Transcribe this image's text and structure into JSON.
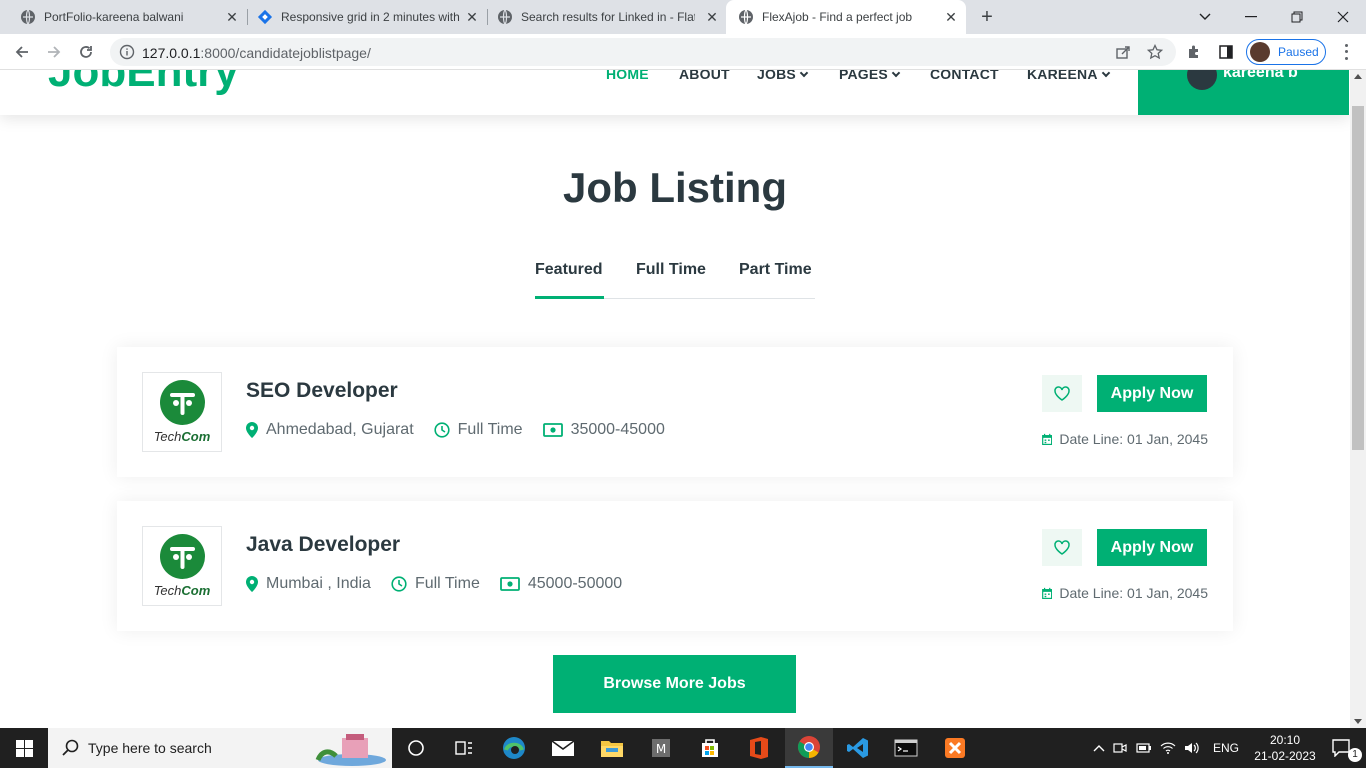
{
  "browser": {
    "tabs": [
      {
        "title": "PortFolio-kareena balwani",
        "active": false
      },
      {
        "title": "Responsive grid in 2 minutes with",
        "active": false
      },
      {
        "title": "Search results for Linked in - Flat",
        "active": false
      },
      {
        "title": "FlexAjob - Find a perfect job",
        "active": true
      }
    ],
    "url_host": "127.0.0.1",
    "url_rest": ":8000/candidatejoblistpage/",
    "profile_label": "Paused"
  },
  "site": {
    "logo": "JobEntry",
    "nav": [
      "HOME",
      "ABOUT",
      "JOBS",
      "PAGES",
      "CONTACT",
      "KAREENA"
    ],
    "user_name": "kareena b"
  },
  "main": {
    "heading": "Job Listing",
    "tabs": [
      "Featured",
      "Full Time",
      "Part Time"
    ],
    "jobs": [
      {
        "company": "TechCom",
        "title": "SEO Developer",
        "location": "Ahmedabad, Gujarat",
        "type": "Full Time",
        "salary": "35000-45000",
        "apply_label": "Apply Now",
        "date_line": "Date Line: 01 Jan, 2045"
      },
      {
        "company": "TechCom",
        "title": "Java Developer",
        "location": "Mumbai , India",
        "type": "Full Time",
        "salary": "45000-50000",
        "apply_label": "Apply Now",
        "date_line": "Date Line: 01 Jan, 2045"
      }
    ],
    "browse_label": "Browse More Jobs"
  },
  "taskbar": {
    "search_placeholder": "Type here to search",
    "language": "ENG",
    "time": "20:10",
    "date": "21-02-2023",
    "notification_count": "1"
  },
  "colors": {
    "accent": "#00b074",
    "text_dark": "#2b3940"
  }
}
